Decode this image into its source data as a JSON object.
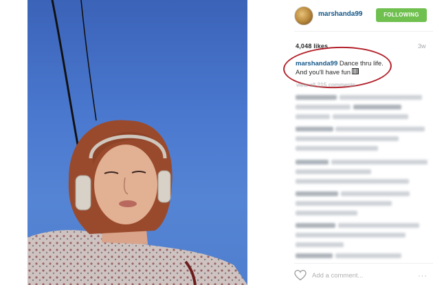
{
  "post": {
    "username": "marshanda99",
    "follow_label": "FOLLOWING",
    "likes": "4,048 likes",
    "time_ago": "3w",
    "caption_user": "marshanda99",
    "caption_text_line1": " Dance thru life.",
    "caption_text_line2": "And you'll have fun",
    "view_all_comments": "view all 215 comments",
    "add_comment_placeholder": "Add a comment...",
    "more_label": "···"
  },
  "colors": {
    "follow_green": "#70c050",
    "username_blue": "#125688",
    "annotation_red": "#b3202a",
    "sky_blue": "#4a78cf"
  },
  "icons": {
    "heart": "heart-outline-icon",
    "more": "ellipsis-icon",
    "caption_emoji": "emoji-icon"
  }
}
